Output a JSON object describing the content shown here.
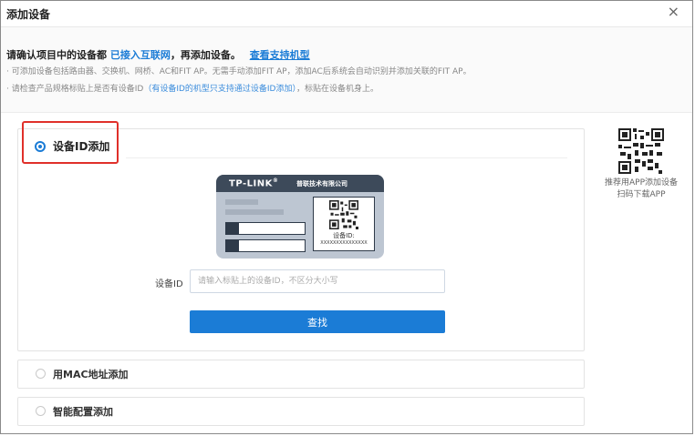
{
  "dialog": {
    "title": "添加设备",
    "close_glyph": "×"
  },
  "info": {
    "main_prefix": "请确认项目中的设备都",
    "main_link": "已接入互联网",
    "main_suffix": "，再添加设备。",
    "support_link": "查看支持机型",
    "note1": "· 可添加设备包括路由器、交换机、网桥、AC和FIT AP。无需手动添加FIT AP，添加AC后系统会自动识别并添加关联的FIT AP。",
    "note2_prefix": "· 请检查产品规格标贴上是否有设备ID",
    "note2_blue": "（有设备ID的机型只支持通过设备ID添加）",
    "note2_suffix": "，标贴在设备机身上。"
  },
  "options": {
    "device_id": {
      "label": "设备ID添加",
      "selected": true,
      "card": {
        "brand": "TP-LINK",
        "brand_mark": "®",
        "brand_cn": "普联技术有限公司",
        "id_label": "设备ID:",
        "id_value": "XXXXXXXXXXXXXXX"
      },
      "field_label": "设备ID",
      "input_placeholder": "请输入标贴上的设备ID，不区分大小写",
      "input_value": "",
      "search_button": "查找"
    },
    "mac": {
      "label": "用MAC地址添加",
      "selected": false
    },
    "smart": {
      "label": "智能配置添加",
      "selected": false
    }
  },
  "app_promo": {
    "text": "推荐用APP添加设备扫码下载APP"
  },
  "colors": {
    "accent": "#1b7cd6",
    "highlight_box": "#e0302a",
    "card_dark": "#3d4a5a",
    "card_body": "#bdc6d2"
  },
  "icons": {
    "close": "close-icon",
    "qr": "qr-code-icon",
    "radio_on": "radio-selected-icon",
    "radio_off": "radio-unselected-icon"
  }
}
